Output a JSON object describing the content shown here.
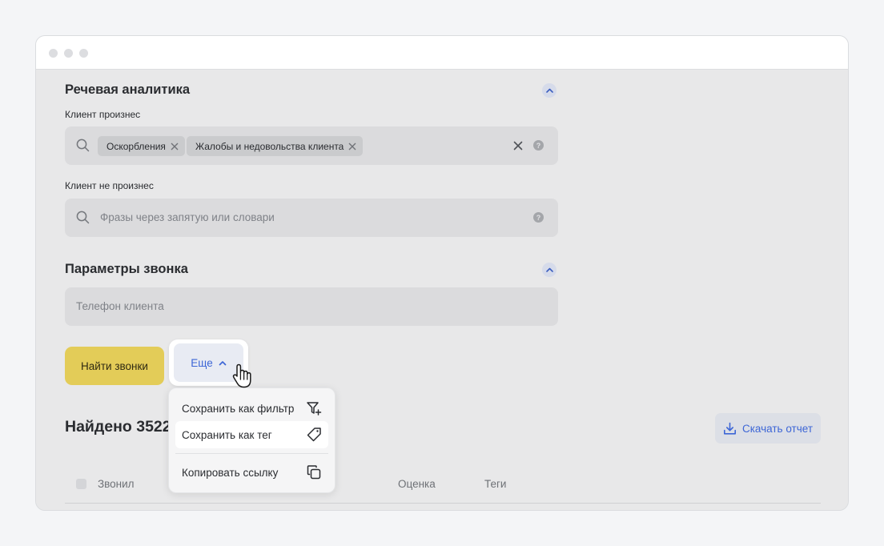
{
  "speech_analytics": {
    "title": "Речевая аналитика",
    "client_said": {
      "label": "Клиент произнес",
      "chips": [
        "Оскорбления",
        "Жалобы и недовольства клиента"
      ]
    },
    "client_not_said": {
      "label": "Клиент не произнес",
      "placeholder": "Фразы через запятую или словари"
    }
  },
  "call_params": {
    "title": "Параметры звонка",
    "phone_placeholder": "Телефон клиента"
  },
  "actions": {
    "find_label": "Найти звонки",
    "more_label": "Еще"
  },
  "dropdown": {
    "items": [
      {
        "label": "Сохранить как фильтр",
        "icon": "filter-plus-icon"
      },
      {
        "label": "Сохранить как тег",
        "icon": "tag-icon"
      },
      {
        "label": "Копировать ссылку",
        "icon": "copy-icon"
      }
    ]
  },
  "results": {
    "found_label": "Найдено 3522",
    "download_label": "Скачать отчет"
  },
  "table": {
    "columns": [
      "Звонил",
      "Оценка",
      "Теги"
    ]
  },
  "colors": {
    "accent": "#3d66d6",
    "primary_button": "#e3cc58"
  }
}
